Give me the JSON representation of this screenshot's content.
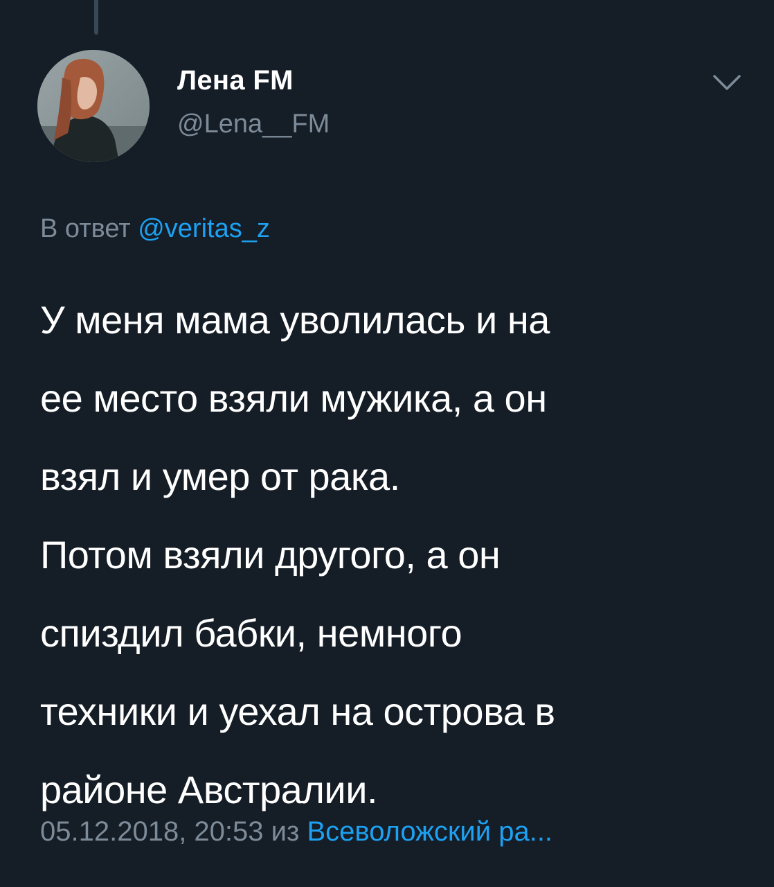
{
  "author": {
    "display_name": "Лена FM",
    "handle": "@Lena__FM"
  },
  "reply": {
    "prefix": "В ответ",
    "mention": "@veritas_z"
  },
  "tweet": {
    "lines": [
      "У меня мама уволилась и на",
      "ее место взяли мужика, а он",
      "взял и умер от рака.",
      "Потом взяли другого, а он",
      "спиздил бабки, немного",
      "техники и уехал на острова в",
      "районе Австралии."
    ]
  },
  "meta": {
    "datetime": "05.12.2018, 20:53",
    "from_label": "из",
    "source": "Всеволожский ра..."
  },
  "icons": {
    "menu": "chevron-down-icon"
  },
  "colors": {
    "background": "#151d27",
    "text_primary": "#ffffff",
    "text_secondary": "#7d8b99",
    "link": "#1da1f2"
  }
}
